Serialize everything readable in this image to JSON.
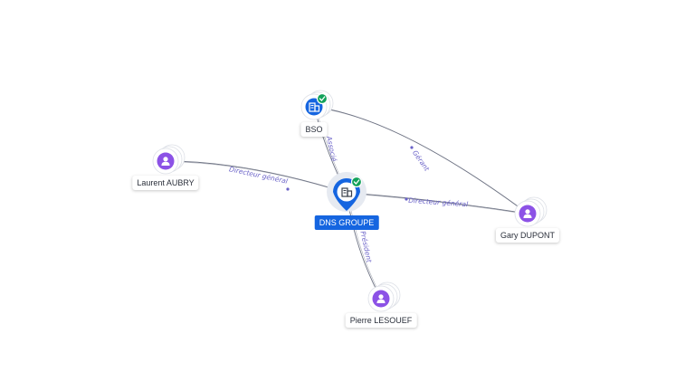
{
  "colors": {
    "person": "#8c52e6",
    "company": "#1565e0",
    "verified": "#12a15a",
    "edge": "#6e7384",
    "edge_label": "#6b63c8"
  },
  "nodes": [
    {
      "id": "dns",
      "label": "DNS GROUPE",
      "kind": "company",
      "icon": "building-icon",
      "verified": true,
      "primary": true
    },
    {
      "id": "bso",
      "label": "BSO",
      "kind": "company",
      "icon": "building-icon",
      "verified": true,
      "primary": false
    },
    {
      "id": "laurent",
      "label": "Laurent AUBRY",
      "kind": "person",
      "icon": "person-icon",
      "verified": false,
      "primary": false
    },
    {
      "id": "gary",
      "label": "Gary DUPONT",
      "kind": "person",
      "icon": "person-icon",
      "verified": false,
      "primary": false
    },
    {
      "id": "pierre",
      "label": "Pierre LESOUEF",
      "kind": "person",
      "icon": "person-icon",
      "verified": false,
      "primary": false
    }
  ],
  "edges": [
    {
      "from": "laurent",
      "to": "dns",
      "label": "Directeur général"
    },
    {
      "from": "gary",
      "to": "dns",
      "label": "Directeur général"
    },
    {
      "from": "dns",
      "to": "bso",
      "label": "Associé"
    },
    {
      "from": "gary",
      "to": "bso",
      "label": "Gérant"
    },
    {
      "from": "pierre",
      "to": "dns",
      "label": "Président"
    }
  ]
}
